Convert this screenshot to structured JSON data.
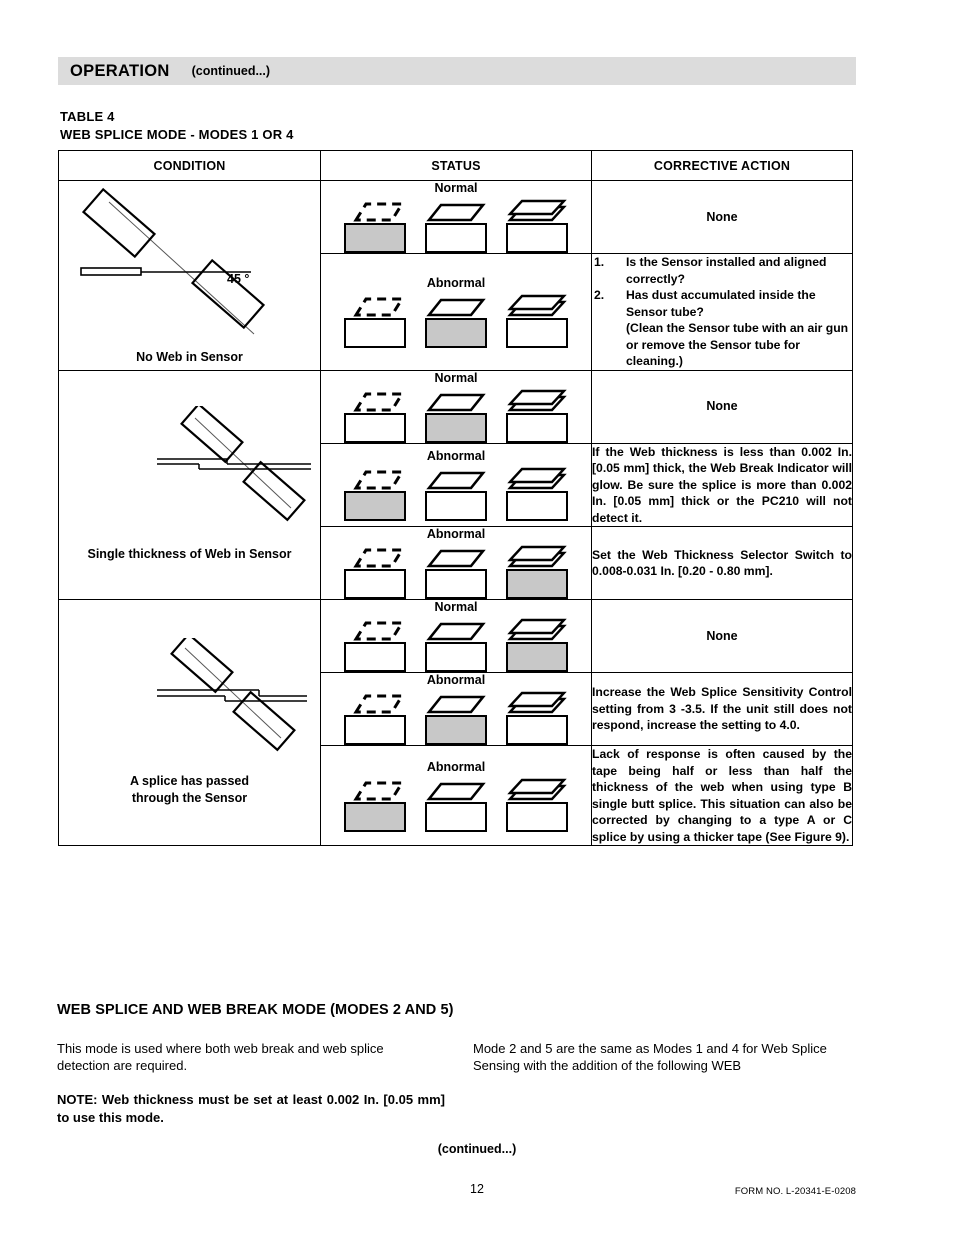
{
  "header": {
    "title": "OPERATION",
    "continued": "(continued...)",
    "band_color": "#dcdcdc"
  },
  "table_caption": {
    "line1": "TABLE  4",
    "line2": "WEB SPLICE MODE - MODES 1 OR 4"
  },
  "columns": {
    "condition": "CONDITION",
    "status": "STATUS",
    "corrective_action": "CORRECTIVE ACTION"
  },
  "labels": {
    "normal": "Normal",
    "abnormal": "Abnormal",
    "none": "None",
    "angle": "45 °"
  },
  "icons": {
    "no_web": "dashed-parallelogram-icon",
    "single_web": "single-parallelogram-icon",
    "splice_web": "stacked-parallelogram-icon",
    "lamp_on_color": "#c8c8c8"
  },
  "conditions": [
    {
      "caption": "No Web in Sensor",
      "diagram": "sensor-no-web-diagram",
      "angle": "45 °"
    },
    {
      "caption": "Single thickness of Web in Sensor",
      "diagram": "sensor-single-web-diagram"
    },
    {
      "caption_line1": "A splice has passed",
      "caption_line2": "through the Sensor",
      "diagram": "sensor-splice-diagram"
    }
  ],
  "rows": [
    {
      "status": "Normal",
      "lamps": [
        true,
        false,
        false
      ],
      "action_type": "center",
      "action": "None"
    },
    {
      "status": "Abnormal",
      "lamps": [
        false,
        true,
        false
      ],
      "action_type": "list",
      "action_items": [
        {
          "num": "1.",
          "text": "Is the Sensor installed and aligned correctly?"
        },
        {
          "num": "2.",
          "text": "Has dust accumulated inside the Sensor tube?"
        }
      ],
      "action_sub": "(Clean the Sensor tube with an air gun or remove the Sensor tube for cleaning.)"
    },
    {
      "status": "Normal",
      "lamps": [
        false,
        true,
        false
      ],
      "action_type": "center",
      "action": "None"
    },
    {
      "status": "Abnormal",
      "lamps": [
        true,
        false,
        false
      ],
      "action_type": "text",
      "action": "If the Web thickness is less than 0.002 In. [0.05 mm] thick, the Web Break Indicator will glow.  Be sure the splice is more than 0.002 In. [0.05 mm] thick or the PC210 will not detect it."
    },
    {
      "status": "Abnormal",
      "lamps": [
        false,
        false,
        true
      ],
      "action_type": "text",
      "action": "Set the Web Thickness Selector Switch to  0.008-0.031 In. [0.20 - 0.80 mm]."
    },
    {
      "status": "Normal",
      "lamps": [
        false,
        false,
        true
      ],
      "action_type": "center",
      "action": "None"
    },
    {
      "status": "Abnormal",
      "lamps": [
        false,
        true,
        false
      ],
      "action_type": "text",
      "action": "Increase the Web Splice Sensitivity Control  setting from 3 -3.5.  If the unit still does not respond, increase the setting to 4.0."
    },
    {
      "status": "Abnormal",
      "lamps": [
        true,
        false,
        false
      ],
      "action_type": "text",
      "action": "Lack of response is often caused by the tape being half or less than half the thickness of the web when using type B single butt splice. This situation can also be corrected by changing to a type A or C splice by using a thicker tape (See Figure 9)."
    }
  ],
  "section": {
    "heading": "WEB SPLICE AND WEB BREAK MODE (MODES 2 AND 5)",
    "left_paragraph": "This mode is used where both web break and web splice detection are required.",
    "left_note": "NOTE: Web thickness must be set at least 0.002 In. [0.05 mm] to use this mode.",
    "right_paragraph": "Mode 2 and 5 are the same as Modes 1 and 4 for Web Splice Sensing with the addition of the following WEB"
  },
  "footer": {
    "continued": "(continued...)",
    "page_number": "12",
    "form_no": "FORM NO. L-20341-E-0208"
  }
}
